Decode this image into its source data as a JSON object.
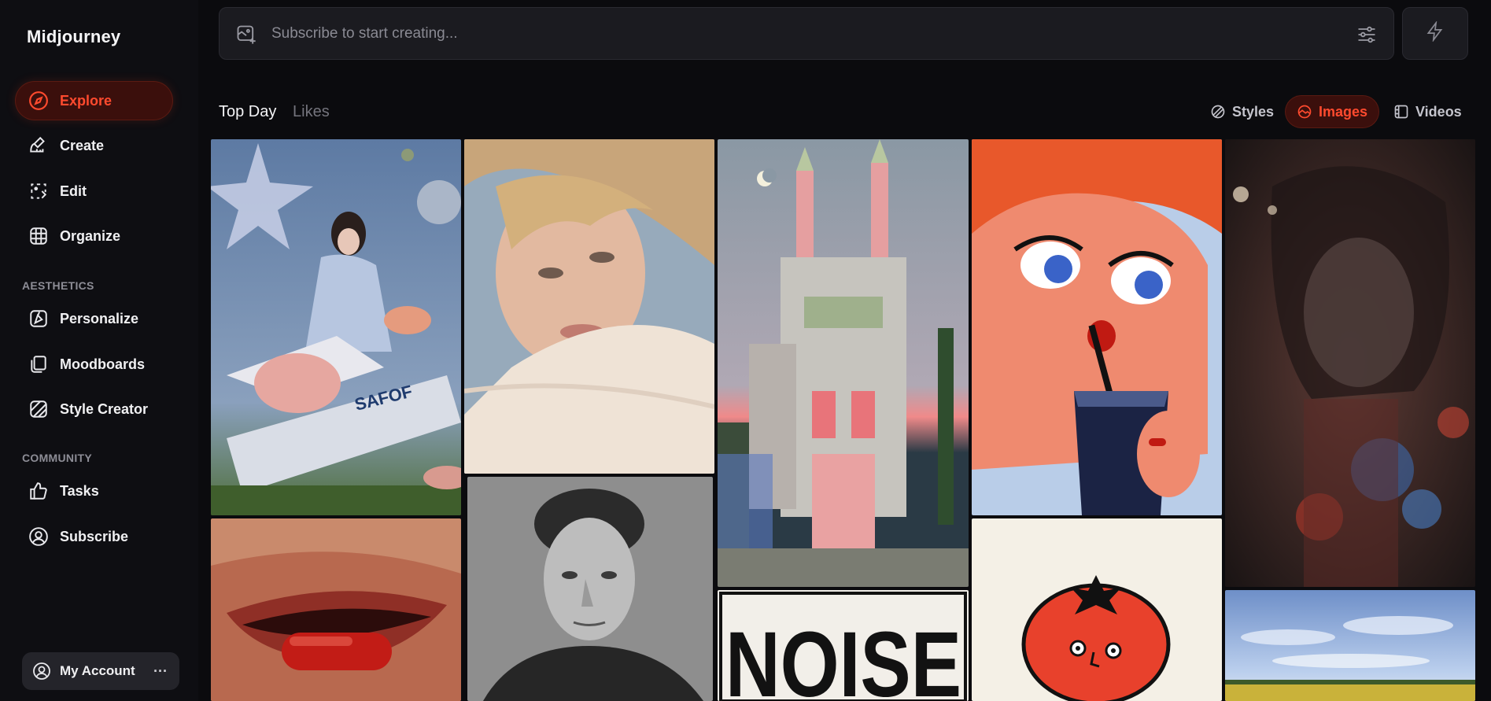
{
  "app": {
    "title": "Midjourney"
  },
  "sidebar": {
    "items": [
      {
        "label": "Explore",
        "icon": "compass-icon",
        "active": true
      },
      {
        "label": "Create",
        "icon": "brush-icon"
      },
      {
        "label": "Edit",
        "icon": "edit-frame-icon"
      },
      {
        "label": "Organize",
        "icon": "grid-icon"
      }
    ],
    "aesthetics_label": "AESTHETICS",
    "aesthetics_items": [
      {
        "label": "Personalize",
        "icon": "personalize-icon"
      },
      {
        "label": "Moodboards",
        "icon": "moodboard-icon"
      },
      {
        "label": "Style Creator",
        "icon": "style-creator-icon"
      }
    ],
    "community_label": "COMMUNITY",
    "community_items": [
      {
        "label": "Tasks",
        "icon": "thumbs-up-icon"
      },
      {
        "label": "Subscribe",
        "icon": "user-circle-icon"
      }
    ],
    "account": {
      "label": "My Account",
      "icon": "user-circle-icon",
      "more": "···"
    }
  },
  "prompt": {
    "placeholder": "Subscribe to start creating..."
  },
  "tabs": [
    {
      "label": "Top Day",
      "active": true
    },
    {
      "label": "Likes",
      "active": false
    }
  ],
  "filters": [
    {
      "label": "Styles",
      "icon": "styles-icon",
      "active": false
    },
    {
      "label": "Images",
      "icon": "image-icon",
      "active": true
    },
    {
      "label": "Videos",
      "icon": "video-icon",
      "active": false
    }
  ],
  "gallery": {
    "tiles": [
      {
        "name": "space-fish-girl"
      },
      {
        "name": "blonde-portrait"
      },
      {
        "name": "pink-castle"
      },
      {
        "name": "cartoon-girl-drink"
      },
      {
        "name": "dark-sparkle-woman"
      },
      {
        "name": "red-lips-pill"
      },
      {
        "name": "bw-man-portrait"
      },
      {
        "name": "noise-poster",
        "text": "NOISE"
      },
      {
        "name": "tomato-character"
      },
      {
        "name": "sky-field"
      }
    ]
  },
  "colors": {
    "accent": "#ff4a2e",
    "active_bg": "#3b0f0c",
    "background": "#0b0b0e"
  }
}
